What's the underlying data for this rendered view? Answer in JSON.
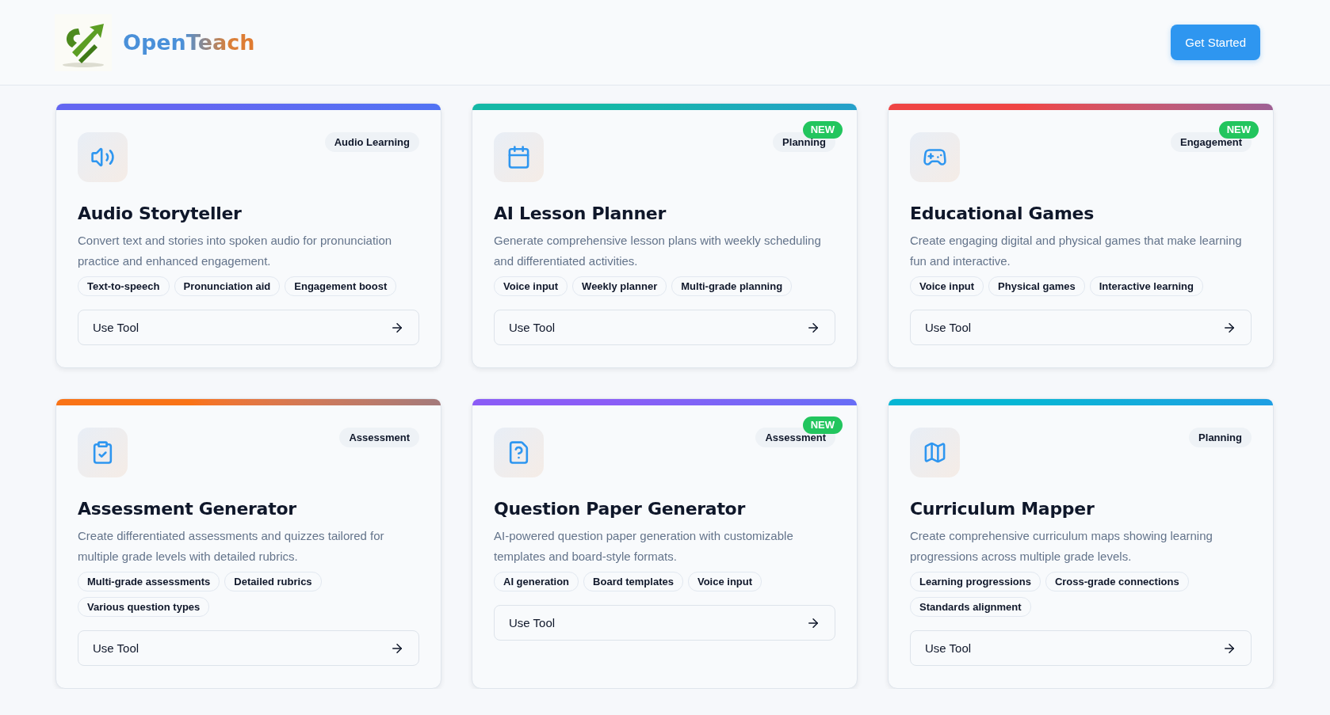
{
  "header": {
    "brand": "OpenTeach",
    "button": "Get Started"
  },
  "cards": [
    {
      "title": "Audio Storyteller",
      "category": "Audio Learning",
      "description": "Convert text and stories into spoken audio for pronunciation practice and enhanced engagement.",
      "tags": [
        "Text-to-speech",
        "Pronunciation aid",
        "Engagement boost"
      ],
      "action": "Use Tool",
      "color": "#6366f1"
    },
    {
      "title": "AI Lesson Planner",
      "category": "Planning",
      "badge": "NEW",
      "description": "Generate comprehensive lesson plans with weekly scheduling and differentiated activities.",
      "tags": [
        "Voice input",
        "Weekly planner",
        "Multi-grade planning"
      ],
      "action": "Use Tool",
      "color": "#14b8a6"
    },
    {
      "title": "Educational Games",
      "category": "Engagement",
      "badge": "NEW",
      "description": "Create engaging digital and physical games that make learning fun and interactive.",
      "tags": [
        "Voice input",
        "Physical games",
        "Interactive learning"
      ],
      "action": "Use Tool",
      "color": "#ef4444"
    },
    {
      "title": "Assessment Generator",
      "category": "Assessment",
      "description": "Create differentiated assessments and quizzes tailored for multiple grade levels with detailed rubrics.",
      "tags": [
        "Multi-grade assessments",
        "Detailed rubrics",
        "Various question types"
      ],
      "action": "Use Tool",
      "color": "#f97316"
    },
    {
      "title": "Question Paper Generator",
      "category": "Assessment",
      "badge": "NEW",
      "description": "AI-powered question paper generation with customizable templates and board-style formats.",
      "tags": [
        "AI generation",
        "Board templates",
        "Voice input"
      ],
      "action": "Use Tool",
      "color": "#8b5cf6"
    },
    {
      "title": "Curriculum Mapper",
      "category": "Planning",
      "description": "Create comprehensive curriculum maps showing learning progressions across multiple grade levels.",
      "tags": [
        "Learning progressions",
        "Cross-grade connections",
        "Standards alignment"
      ],
      "action": "Use Tool",
      "color": "#06b6d4"
    }
  ]
}
